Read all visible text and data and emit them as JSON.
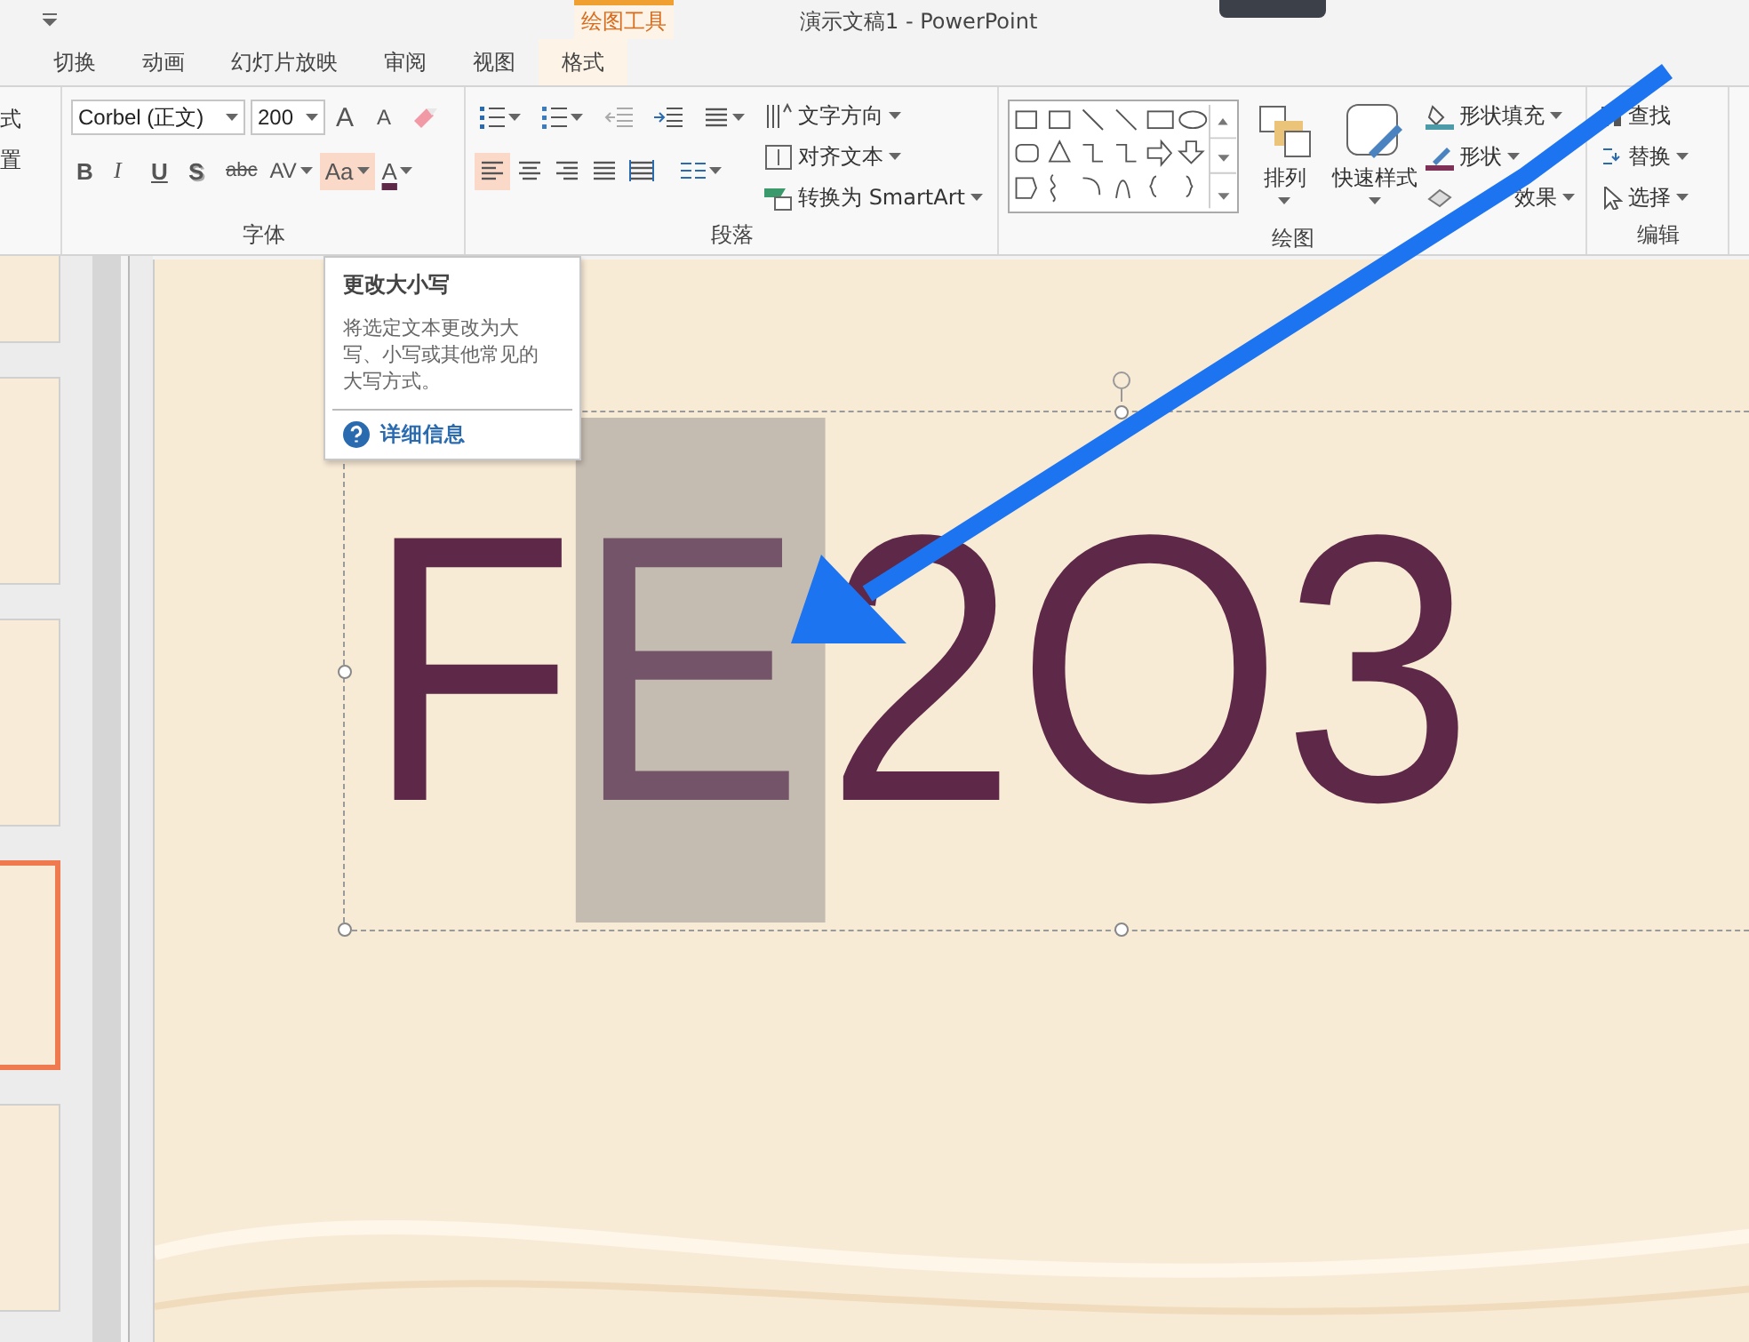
{
  "title_bar": {
    "context_group": "绘图工具",
    "title": "演示文稿1 - PowerPoint"
  },
  "tabs": [
    {
      "label": "切换",
      "selected": false
    },
    {
      "label": "动画",
      "selected": false
    },
    {
      "label": "幻灯片放映",
      "selected": false
    },
    {
      "label": "审阅",
      "selected": false
    },
    {
      "label": "视图",
      "selected": false
    },
    {
      "label": "格式",
      "selected": true
    }
  ],
  "ribbon": {
    "partial_group": [
      "式",
      "置"
    ],
    "font": {
      "name": "Corbel (正文)",
      "size": "200",
      "grow": "A",
      "shrink": "A",
      "label": "字体",
      "buttons": [
        {
          "label": "B",
          "kind": "bold",
          "highlighted": false
        },
        {
          "label": "I",
          "kind": "italic",
          "highlighted": false
        },
        {
          "label": "U",
          "kind": "underline",
          "highlighted": false
        },
        {
          "label": "S",
          "kind": "shadow",
          "highlighted": false
        },
        {
          "label": "abc",
          "kind": "strike",
          "highlighted": false
        },
        {
          "label": "AV",
          "kind": "spacing",
          "highlighted": false
        },
        {
          "label": "Aa",
          "kind": "case",
          "highlighted": true
        },
        {
          "label": "A",
          "kind": "color",
          "highlighted": false
        }
      ]
    },
    "paragraph": {
      "label": "段落",
      "commands": [
        "文字方向",
        "对齐文本",
        "转换为 SmartArt"
      ],
      "align": [
        {
          "kind": "left",
          "selected": true
        },
        {
          "kind": "center",
          "selected": false
        },
        {
          "kind": "right",
          "selected": false
        },
        {
          "kind": "justify",
          "selected": false
        },
        {
          "kind": "distributed",
          "selected": false
        }
      ]
    },
    "drawing": {
      "label": "绘图",
      "arrange": "排列",
      "quick_styles": "快速样式",
      "commands": [
        {
          "label": "形状填充",
          "kind": "fill"
        },
        {
          "label": "形状",
          "kind": "outline"
        },
        {
          "label": "效果",
          "kind": "effects"
        }
      ]
    },
    "editing": {
      "label": "编辑",
      "commands": [
        "查找",
        "替换",
        "选择"
      ]
    }
  },
  "tooltip": {
    "title": "更改大小写",
    "body": "将选定文本更改为大写、小写或其他常见的大写方式。",
    "link": "详细信息"
  },
  "thumbnails": [
    {
      "selected": false
    },
    {
      "selected": false
    },
    {
      "selected": false
    },
    {
      "selected": true
    },
    {
      "selected": false
    }
  ],
  "slide": {
    "text": [
      {
        "text": "F",
        "selected": false
      },
      {
        "text": "E",
        "selected": true
      },
      {
        "text": "2O3",
        "selected": false
      }
    ]
  }
}
